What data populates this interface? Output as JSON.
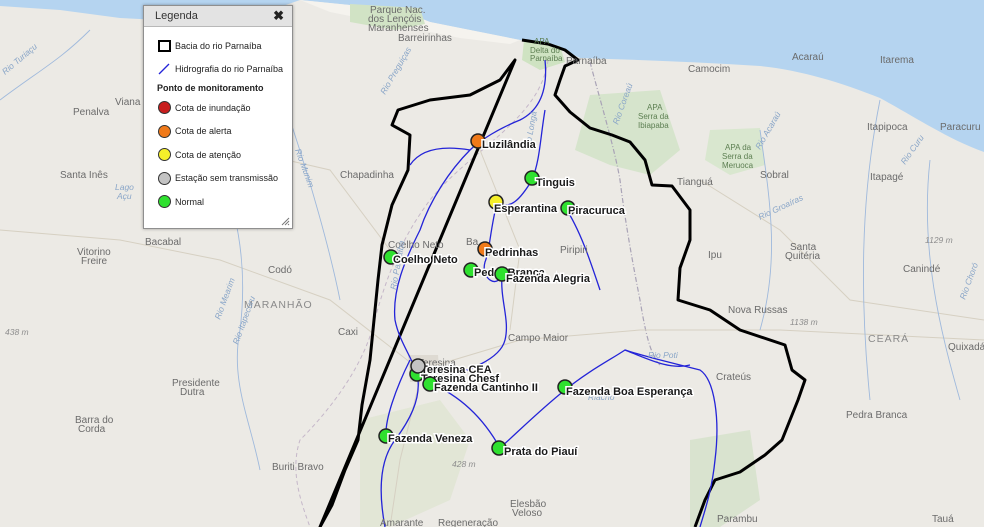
{
  "legend": {
    "title": "Legenda",
    "close_glyph": "✖",
    "items": {
      "basin": "Bacia do rio Parnaíba",
      "hydro": "Hidrografia do rio Parnaíba"
    },
    "section_title": "Ponto de monitoramento",
    "statuses": [
      {
        "label": "Cota de inundação",
        "color": "#c81e1e"
      },
      {
        "label": "Cota de alerta",
        "color": "#f07a1a"
      },
      {
        "label": "Cota de atenção",
        "color": "#f5ef2a"
      },
      {
        "label": "Estação sem transmissão",
        "color": "#c3c3c3"
      },
      {
        "label": "Normal",
        "color": "#2fe02f"
      }
    ]
  },
  "stations": [
    {
      "name": "Luzilândia",
      "status": "alerta"
    },
    {
      "name": "Tinguis",
      "status": "normal"
    },
    {
      "name": "Esperantina",
      "status": "atencao"
    },
    {
      "name": "Piracuruca",
      "status": "normal"
    },
    {
      "name": "Pedrinhas",
      "status": "alerta"
    },
    {
      "name": "Coelho Neto",
      "status": "normal"
    },
    {
      "name": "Pedra Branca",
      "status": "normal"
    },
    {
      "name": "Fazenda Alegria",
      "status": "normal"
    },
    {
      "name": "Teresina CEA",
      "status": "normal"
    },
    {
      "name": "Teresina Chesf",
      "status": "sem_transmissao"
    },
    {
      "name": "Fazenda Cantinho II",
      "status": "normal"
    },
    {
      "name": "Fazenda Boa Esperança",
      "status": "normal"
    },
    {
      "name": "Fazenda Veneza",
      "status": "normal"
    },
    {
      "name": "Prata do Piauí",
      "status": "normal"
    }
  ],
  "map_labels": {
    "parque1": "Parque Nac.",
    "parque2": "dos Lençóis",
    "parque3": "Maranhenses",
    "barreirinhas": "Barreirinhas",
    "apa1": "APA",
    "apa2": "Delta do",
    "apa3": "Parnaíba",
    "parnaiba": "Parnaíba",
    "camocim": "Camocim",
    "acarau": "Acaraú",
    "itarema": "Itarema",
    "apa_ibiapaba1": "APA",
    "apa_ibiapaba2": "Serra da",
    "apa_ibiapaba3": "Ibiapaba",
    "apa_meruoca1": "APA da",
    "apa_meruoca2": "Serra da",
    "apa_meruoca3": "Meruoca",
    "itapipoca": "Itapipoca",
    "paracuru": "Paracuru",
    "viana": "Viana",
    "penalva": "Penalva",
    "santa_ines": "Santa Inês",
    "lago_acu1": "Lago",
    "lago_acu2": "Açu",
    "chapadinha": "Chapadinha",
    "tiangua": "Tianguá",
    "sobral": "Sobral",
    "itapage": "Itapagé",
    "bacabal": "Bacabal",
    "vitorino1": "Vitorino",
    "vitorino2": "Freire",
    "codo": "Codó",
    "maranhao": "MARANHÃO",
    "elev438": "438 m",
    "coelho_neto_town": "Coelho Neto",
    "barras": "Ba",
    "pirripiri": "Piripiri",
    "ipu": "Ipu",
    "santa_quiteria1": "Santa",
    "santa_quiteria2": "Quitéria",
    "caninde": "Canindé",
    "elev1129": "1129 m",
    "elev1138": "1138 m",
    "novas_russas": "Nova Russas",
    "caxias": "Caxi",
    "campo_maior": "Campo Maior",
    "ceara": "CEARÁ",
    "quixada": "Quixadá",
    "teresina_town": "Teresina",
    "presidente1": "Presidente",
    "presidente2": "Dutra",
    "crateus": "Crateús",
    "barra1": "Barra do",
    "barra2": "Corda",
    "pedra_branca": "Pedra Branca",
    "elev428": "428 m",
    "buriti": "Buriti Bravo",
    "elesbao1": "Elesbão",
    "elesbao2": "Veloso",
    "amarante": "Amarante",
    "regeneracao": "Regeneração",
    "parambu": "Parambu",
    "taua": "Tauá",
    "rio_turiacu": "Rio Turiaçu",
    "rio_munim": "Rio Munim",
    "rio_preguicas": "Rio Preguiças",
    "rio_itapecuru": "Rio Itapecuru",
    "rio_parnaiba": "Rio Parnaíba",
    "rio_longa": "Rio Longá",
    "rio_poti": "Rio Poti",
    "rio_coreau": "Rio Coreaú",
    "rio_acarau": "Rio Acaraú",
    "rio_groairas": "Rio Groaíras",
    "rio_curu": "Rio Curu",
    "rio_choro": "Rio Choró",
    "rio_mearim": "Rio Mearim",
    "riacho": "Riacho"
  }
}
